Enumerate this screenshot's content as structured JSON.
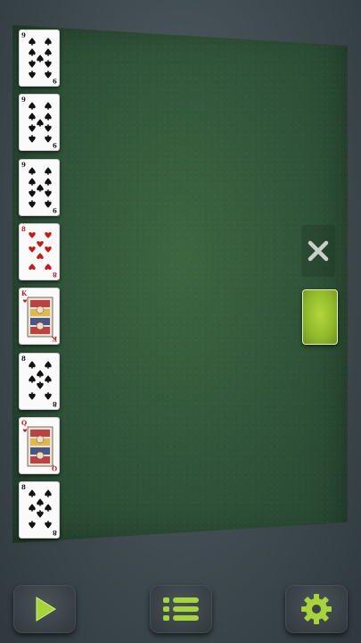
{
  "colors": {
    "felt": "#31553a",
    "accent_green": "#9bc832",
    "card_face": "#fafafa",
    "red_suit": "#c21d1d",
    "black_suit": "#111111"
  },
  "cards": [
    {
      "rank": "9",
      "suit": "spades",
      "color": "black"
    },
    {
      "rank": "9",
      "suit": "spades",
      "color": "black"
    },
    {
      "rank": "9",
      "suit": "spades",
      "color": "black"
    },
    {
      "rank": "8",
      "suit": "hearts",
      "color": "red"
    },
    {
      "rank": "K",
      "suit": "hearts",
      "color": "red"
    },
    {
      "rank": "8",
      "suit": "spades",
      "color": "black"
    },
    {
      "rank": "Q",
      "suit": "hearts",
      "color": "red"
    },
    {
      "rank": "8",
      "suit": "spades",
      "color": "black"
    }
  ],
  "toolbar": {
    "play_icon": "play-icon",
    "menu_icon": "menu-list-icon",
    "settings_icon": "gear-icon"
  },
  "side": {
    "close_icon": "close-icon",
    "stock": "card-back"
  }
}
